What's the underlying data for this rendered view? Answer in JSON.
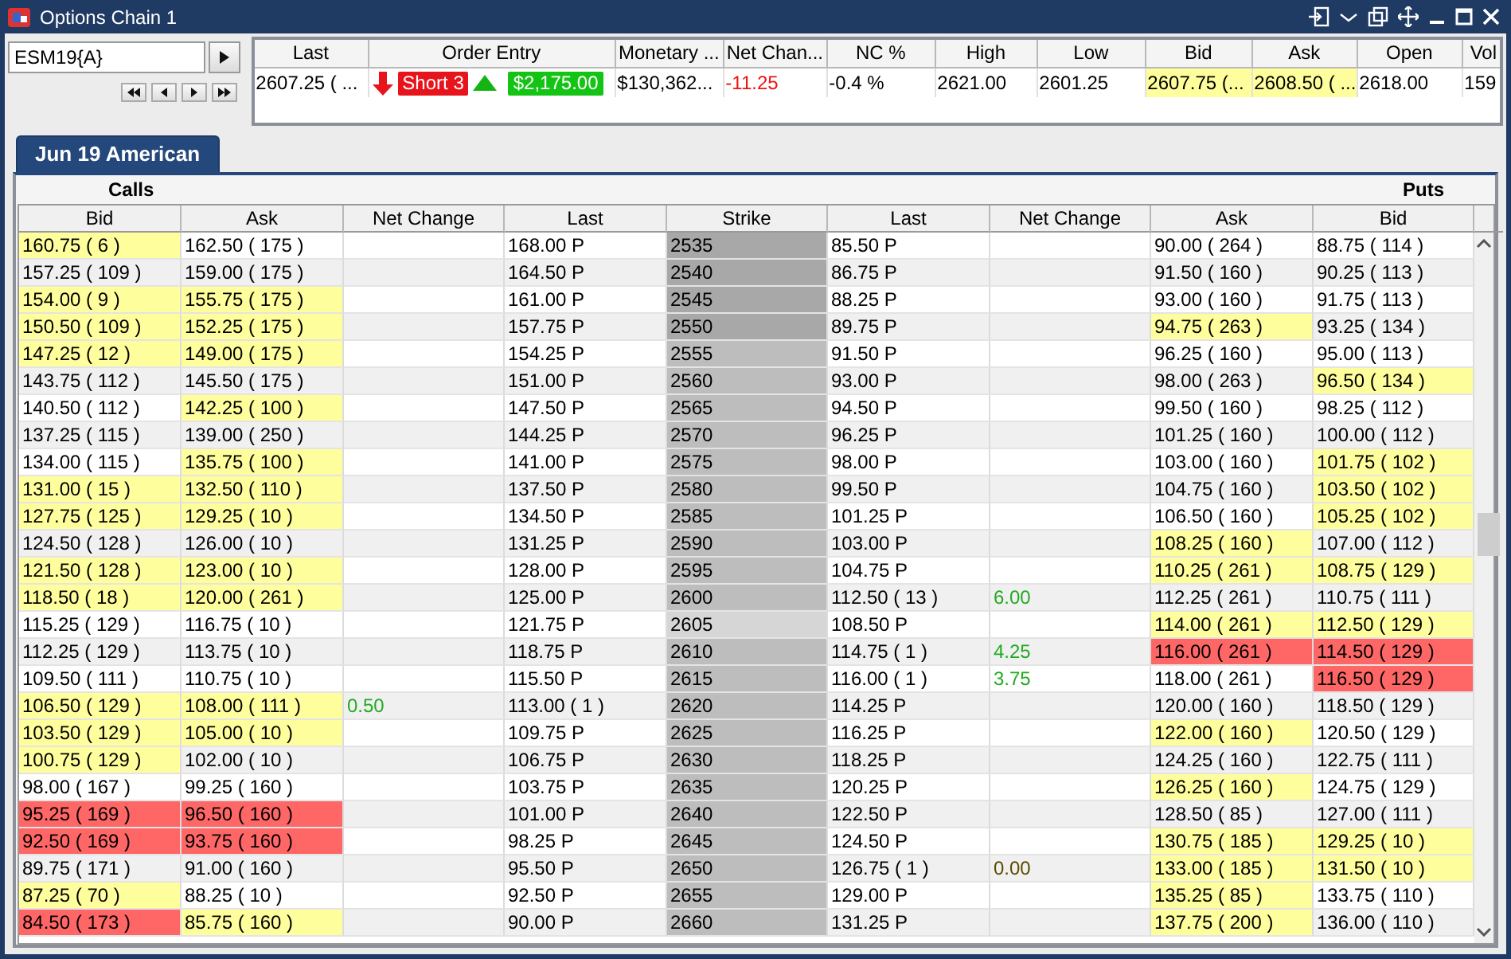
{
  "window": {
    "title": "Options Chain 1"
  },
  "symbol": {
    "value": "ESM19{A}"
  },
  "quote": {
    "columns": [
      "Last",
      "Order Entry",
      "Monetary ...",
      "Net Chan...",
      "NC %",
      "High",
      "Low",
      "Bid",
      "Ask",
      "Open",
      "Vol"
    ],
    "cells": [
      {
        "kind": "text",
        "text": "2607.25 ( ..."
      },
      {
        "kind": "order",
        "position": "Short 3",
        "pnl": "$2,175.00"
      },
      {
        "kind": "text",
        "text": "$130,362..."
      },
      {
        "kind": "change",
        "text": "-11.25",
        "color": "#ee1111"
      },
      {
        "kind": "text",
        "text": "-0.4 %"
      },
      {
        "kind": "text",
        "text": "2621.00"
      },
      {
        "kind": "text",
        "text": "2601.25"
      },
      {
        "kind": "text",
        "text": "2607.75 (...",
        "color": "#fffe9c"
      },
      {
        "kind": "text",
        "text": "2608.50 ( ...",
        "color": "#fffe9c"
      },
      {
        "kind": "text",
        "text": "2618.00"
      },
      {
        "kind": "text",
        "text": "159"
      }
    ]
  },
  "tabs": [
    {
      "label": "Jun 19 American",
      "selected": true
    }
  ],
  "chain": {
    "calls_label": "Calls",
    "puts_label": "Puts",
    "columns": [
      "Bid",
      "Ask",
      "Net Change",
      "Last",
      "Strike",
      "Last",
      "Net Change",
      "Ask",
      "Bid"
    ],
    "rows": [
      {
        "cells": [
          {
            "text": "160.75 ( 6 )",
            "color": "#fffe9c"
          },
          "162.50 ( 175 )",
          null,
          "168.00 P",
          {
            "text": "2535",
            "color": "#a8a8a8"
          },
          "85.50 P",
          null,
          "90.00 ( 264 )",
          "88.75 ( 114 )"
        ]
      },
      {
        "cells": [
          "157.25 ( 109 )",
          "159.00 ( 175 )",
          null,
          "164.50 P",
          {
            "text": "2540",
            "color": "#a8a8a8"
          },
          "86.75 P",
          null,
          "91.50 ( 160 )",
          "90.25 ( 113 )"
        ]
      },
      {
        "cells": [
          {
            "text": "154.00 ( 9 )",
            "color": "#fffe9c"
          },
          {
            "text": "155.75 ( 175 )",
            "color": "#fffe9c"
          },
          null,
          "161.00 P",
          {
            "text": "2545",
            "color": "#a8a8a8"
          },
          "88.25 P",
          null,
          "93.00 ( 160 )",
          "91.75 ( 113 )"
        ]
      },
      {
        "cells": [
          {
            "text": "150.50 ( 109 )",
            "color": "#fffe9c"
          },
          {
            "text": "152.25 ( 175 )",
            "color": "#fffe9c"
          },
          null,
          "157.75 P",
          {
            "text": "2550",
            "color": "#a8a8a8"
          },
          "89.75 P",
          null,
          {
            "text": "94.75 ( 263 )",
            "color": "#fffe9c"
          },
          "93.25 ( 134 )"
        ]
      },
      {
        "cells": [
          {
            "text": "147.25 ( 12 )",
            "color": "#fffe9c"
          },
          {
            "text": "149.00 ( 175 )",
            "color": "#fffe9c"
          },
          null,
          "154.25 P",
          {
            "text": "2555",
            "color": "#bdbdbd"
          },
          "91.50 P",
          null,
          "96.25 ( 160 )",
          "95.00 ( 113 )"
        ]
      },
      {
        "cells": [
          "143.75 ( 112 )",
          "145.50 ( 175 )",
          null,
          "151.00 P",
          {
            "text": "2560",
            "color": "#bdbdbd"
          },
          "93.00 P",
          null,
          "98.00 ( 263 )",
          {
            "text": "96.50 ( 134 )",
            "color": "#fffe9c"
          }
        ]
      },
      {
        "cells": [
          "140.50 ( 112 )",
          {
            "text": "142.25 ( 100 )",
            "color": "#fffe9c"
          },
          null,
          "147.50 P",
          {
            "text": "2565",
            "color": "#bdbdbd"
          },
          "94.50 P",
          null,
          "99.50 ( 160 )",
          "98.25 ( 112 )"
        ]
      },
      {
        "cells": [
          "137.25 ( 115 )",
          "139.00 ( 250 )",
          null,
          "144.25 P",
          {
            "text": "2570",
            "color": "#bdbdbd"
          },
          "96.25 P",
          null,
          "101.25 ( 160 )",
          "100.00 ( 112 )"
        ]
      },
      {
        "cells": [
          "134.00 ( 115 )",
          {
            "text": "135.75 ( 100 )",
            "color": "#fffe9c"
          },
          null,
          "141.00 P",
          {
            "text": "2575",
            "color": "#bdbdbd"
          },
          "98.00 P",
          null,
          "103.00 ( 160 )",
          {
            "text": "101.75 ( 102 )",
            "color": "#fffe9c"
          }
        ]
      },
      {
        "cells": [
          {
            "text": "131.00 ( 15 )",
            "color": "#fffe9c"
          },
          {
            "text": "132.50 ( 110 )",
            "color": "#fffe9c"
          },
          null,
          "137.50 P",
          {
            "text": "2580",
            "color": "#bdbdbd"
          },
          "99.50 P",
          null,
          "104.75 ( 160 )",
          {
            "text": "103.50 ( 102 )",
            "color": "#fffe9c"
          }
        ]
      },
      {
        "cells": [
          {
            "text": "127.75 ( 125 )",
            "color": "#fffe9c"
          },
          {
            "text": "129.25 ( 10 )",
            "color": "#fffe9c"
          },
          null,
          "134.50 P",
          {
            "text": "2585",
            "color": "#bdbdbd"
          },
          "101.25 P",
          null,
          "106.50 ( 160 )",
          {
            "text": "105.25 ( 102 )",
            "color": "#fffe9c"
          }
        ]
      },
      {
        "cells": [
          "124.50 ( 128 )",
          "126.00 ( 10 )",
          null,
          "131.25 P",
          {
            "text": "2590",
            "color": "#bdbdbd"
          },
          "103.00 P",
          null,
          {
            "text": "108.25 ( 160 )",
            "color": "#fffe9c"
          },
          "107.00 ( 112 )"
        ]
      },
      {
        "cells": [
          {
            "text": "121.50 ( 128 )",
            "color": "#fffe9c"
          },
          {
            "text": "123.00 ( 10 )",
            "color": "#fffe9c"
          },
          null,
          "128.00 P",
          {
            "text": "2595",
            "color": "#bdbdbd"
          },
          "104.75 P",
          null,
          {
            "text": "110.25 ( 261 )",
            "color": "#fffe9c"
          },
          {
            "text": "108.75 ( 129 )",
            "color": "#fffe9c"
          }
        ]
      },
      {
        "cells": [
          {
            "text": "118.50 ( 18 )",
            "color": "#fffe9c"
          },
          {
            "text": "120.00 ( 261 )",
            "color": "#fffe9c"
          },
          null,
          "125.00 P",
          {
            "text": "2600",
            "color": "#bdbdbd"
          },
          "112.50 ( 13 )",
          {
            "text": "6.00",
            "color": "#22aa22"
          },
          "112.25 ( 261 )",
          "110.75 ( 111 )"
        ]
      },
      {
        "cells": [
          "115.25 ( 129 )",
          "116.75 ( 10 )",
          null,
          "121.75 P",
          {
            "text": "2605",
            "color": "#d6d6d6"
          },
          "108.50 P",
          null,
          {
            "text": "114.00 ( 261 )",
            "color": "#fffe9c"
          },
          {
            "text": "112.50 ( 129 )",
            "color": "#fffe9c"
          }
        ]
      },
      {
        "cells": [
          "112.25 ( 129 )",
          "113.75 ( 10 )",
          null,
          "118.75 P",
          {
            "text": "2610",
            "color": "#bdbdbd"
          },
          "114.75 ( 1 )",
          {
            "text": "4.25",
            "color": "#22aa22"
          },
          {
            "text": "116.00 ( 261 )",
            "color": "#ff6666"
          },
          {
            "text": "114.50 ( 129 )",
            "color": "#ff6666"
          }
        ]
      },
      {
        "cells": [
          "109.50 ( 111 )",
          "110.75 ( 10 )",
          null,
          "115.50 P",
          {
            "text": "2615",
            "color": "#bdbdbd"
          },
          "116.00 ( 1 )",
          {
            "text": "3.75",
            "color": "#22aa22"
          },
          "118.00 ( 261 )",
          {
            "text": "116.50 ( 129 )",
            "color": "#ff6666"
          }
        ]
      },
      {
        "cells": [
          {
            "text": "106.50 ( 129 )",
            "color": "#fffe9c"
          },
          {
            "text": "108.00 ( 111 )",
            "color": "#fffe9c"
          },
          {
            "text": "0.50",
            "color": "#22aa22"
          },
          "113.00 ( 1 )",
          {
            "text": "2620",
            "color": "#bdbdbd"
          },
          "114.25 P",
          null,
          "120.00 ( 160 )",
          "118.50 ( 129 )"
        ]
      },
      {
        "cells": [
          {
            "text": "103.50 ( 129 )",
            "color": "#fffe9c"
          },
          {
            "text": "105.00 ( 10 )",
            "color": "#fffe9c"
          },
          null,
          "109.75 P",
          {
            "text": "2625",
            "color": "#bdbdbd"
          },
          "116.25 P",
          null,
          {
            "text": "122.00 ( 160 )",
            "color": "#fffe9c"
          },
          "120.50 ( 129 )"
        ]
      },
      {
        "cells": [
          {
            "text": "100.75 ( 129 )",
            "color": "#fffe9c"
          },
          "102.00 ( 10 )",
          null,
          "106.75 P",
          {
            "text": "2630",
            "color": "#bdbdbd"
          },
          "118.25 P",
          null,
          "124.25 ( 160 )",
          "122.75 ( 111 )"
        ]
      },
      {
        "cells": [
          "98.00 ( 167 )",
          "99.25 ( 160 )",
          null,
          "103.75 P",
          {
            "text": "2635",
            "color": "#bdbdbd"
          },
          "120.25 P",
          null,
          {
            "text": "126.25 ( 160 )",
            "color": "#fffe9c"
          },
          "124.75 ( 129 )"
        ]
      },
      {
        "cells": [
          {
            "text": "95.25 ( 169 )",
            "color": "#ff6666"
          },
          {
            "text": "96.50 ( 160 )",
            "color": "#ff6666"
          },
          null,
          "101.00 P",
          {
            "text": "2640",
            "color": "#bdbdbd"
          },
          "122.50 P",
          null,
          "128.50 ( 85 )",
          "127.00 ( 111 )"
        ]
      },
      {
        "cells": [
          {
            "text": "92.50 ( 169 )",
            "color": "#ff6666"
          },
          {
            "text": "93.75 ( 160 )",
            "color": "#ff6666"
          },
          null,
          "98.25 P",
          {
            "text": "2645",
            "color": "#bdbdbd"
          },
          "124.50 P",
          null,
          {
            "text": "130.75 ( 185 )",
            "color": "#fffe9c"
          },
          {
            "text": "129.25 ( 10 )",
            "color": "#fffe9c"
          }
        ]
      },
      {
        "cells": [
          "89.75 ( 171 )",
          "91.00 ( 160 )",
          null,
          "95.50 P",
          {
            "text": "2650",
            "color": "#bdbdbd"
          },
          "126.75 ( 1 )",
          {
            "text": "0.00",
            "color": "#5a4a00"
          },
          {
            "text": "133.00 ( 185 )",
            "color": "#fffe9c"
          },
          {
            "text": "131.50 ( 10 )",
            "color": "#fffe9c"
          }
        ]
      },
      {
        "cells": [
          {
            "text": "87.25 ( 70 )",
            "color": "#fffe9c"
          },
          "88.25 ( 10 )",
          null,
          "92.50 P",
          {
            "text": "2655",
            "color": "#bdbdbd"
          },
          "129.00 P",
          null,
          {
            "text": "135.25 ( 85 )",
            "color": "#fffe9c"
          },
          "133.75 ( 110 )"
        ]
      },
      {
        "cells": [
          {
            "text": "84.50 ( 173 )",
            "color": "#ff6666"
          },
          {
            "text": "85.75 ( 160 )",
            "color": "#fffe9c"
          },
          null,
          "90.00 P",
          {
            "text": "2660",
            "color": "#bdbdbd"
          },
          "131.25 P",
          null,
          {
            "text": "137.75 ( 200 )",
            "color": "#fffe9c"
          },
          "136.00 ( 110 )"
        ]
      }
    ]
  }
}
